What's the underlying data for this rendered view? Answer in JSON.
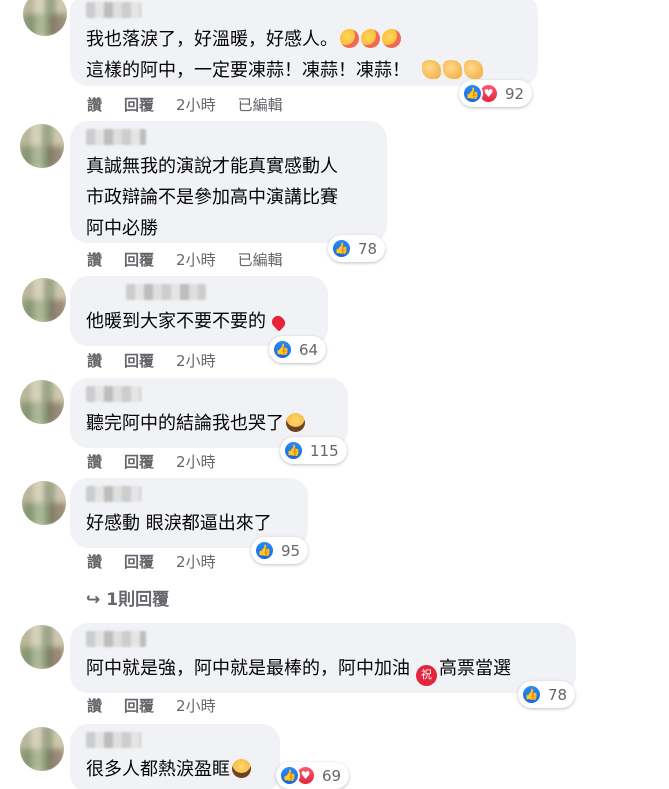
{
  "comments": [
    {
      "lines": [
        "我也落淚了，好溫暖，好感人。",
        "這樣的阿中，一定要凍蒜！凍蒜！凍蒜！"
      ],
      "actions": {
        "like": "讚",
        "reply": "回覆",
        "time": "2小時",
        "edited": "已編輯"
      },
      "reaction_count": "92"
    },
    {
      "lines": [
        "真誠無我的演說才能真實感動人",
        "市政辯論不是參加高中演講比賽",
        "阿中必勝"
      ],
      "actions": {
        "like": "讚",
        "reply": "回覆",
        "time": "2小時",
        "edited": "已編輯"
      },
      "reaction_count": "78"
    },
    {
      "lines": [
        "他暖到大家不要不要的"
      ],
      "actions": {
        "like": "讚",
        "reply": "回覆",
        "time": "2小時"
      },
      "reaction_count": "64"
    },
    {
      "lines": [
        "聽完阿中的結論我也哭了"
      ],
      "actions": {
        "like": "讚",
        "reply": "回覆",
        "time": "2小時"
      },
      "reaction_count": "115"
    },
    {
      "lines": [
        "好感動 眼淚都逼出來了"
      ],
      "actions": {
        "like": "讚",
        "reply": "回覆",
        "time": "2小時"
      },
      "reaction_count": "95"
    },
    {
      "lines": [
        "阿中就是強，阿中就是最棒的，阿中加油",
        "高票當選"
      ],
      "actions": {
        "like": "讚",
        "reply": "回覆",
        "time": "2小時"
      },
      "reaction_count": "78"
    },
    {
      "lines": [
        "很多人都熱淚盈眶"
      ],
      "reaction_count": "69"
    }
  ],
  "reply_link": {
    "arrow": "↪",
    "label": "1則回覆"
  },
  "emoji": {
    "blessing_char": "祝",
    "like_glyph": "👍",
    "love_glyph": "♥"
  },
  "colors": {
    "bubble": "#f0f2f5",
    "meta_text": "#65676b",
    "like_blue": "#1877f2",
    "love_red": "#e5243b"
  }
}
